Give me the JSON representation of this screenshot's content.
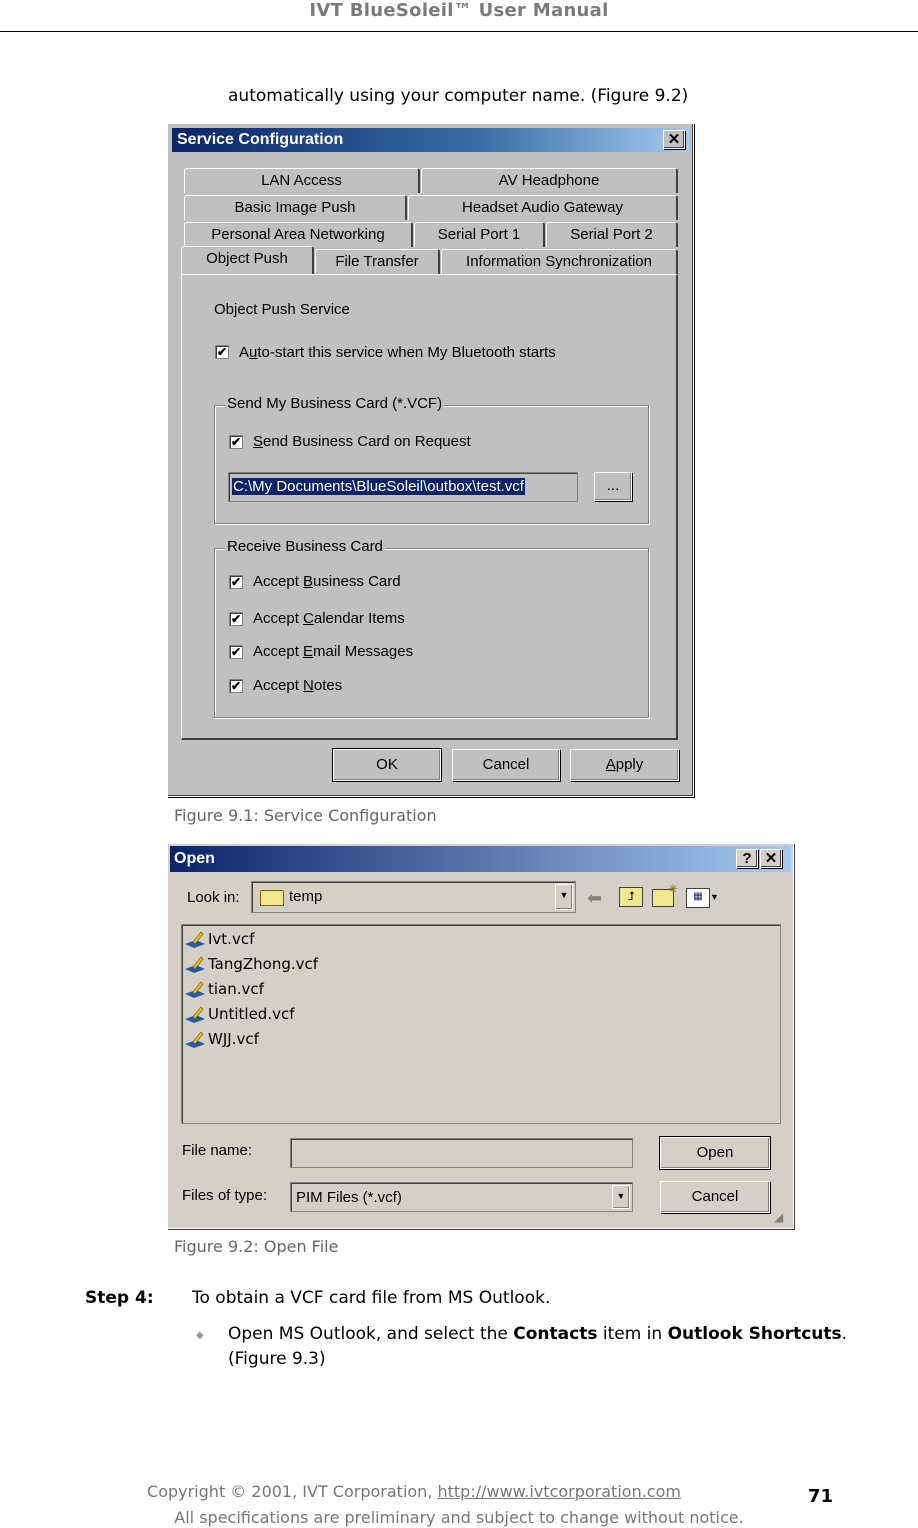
{
  "header": {
    "title": "IVT BlueSoleil™ User Manual"
  },
  "intro_text": "automatically using your computer name. (Figure 9.2)",
  "service_dialog": {
    "title": "Service Configuration",
    "close_label": "✕",
    "tab_rows": [
      [
        "LAN Access",
        "AV Headphone"
      ],
      [
        "Basic Image Push",
        "Headset Audio Gateway"
      ],
      [
        "Personal Area Networking",
        "Serial Port 1",
        "Serial Port 2"
      ],
      [
        "Object Push",
        "File Transfer",
        "Information Synchronization"
      ]
    ],
    "active_tab": "Object Push",
    "section_title": "Object Push Service",
    "autostart": {
      "label_pre": "A",
      "label_u": "u",
      "label_post": "to-start this service when My Bluetooth starts",
      "checked": true
    },
    "send_group": {
      "label": "Send My Business Card (*.VCF)",
      "send_on_request": {
        "label_u": "S",
        "label_post": "end Business Card on Request",
        "checked": true
      },
      "path_value": "C:\\My Documents\\BlueSoleil\\outbox\\test.vcf",
      "browse_label": "..."
    },
    "receive_group": {
      "label": "Receive Business Card",
      "items": [
        {
          "pre": "Accept ",
          "u": "B",
          "post": "usiness Card",
          "checked": true
        },
        {
          "pre": "Accept ",
          "u": "C",
          "post": "alendar Items",
          "checked": true
        },
        {
          "pre": "Accept ",
          "u": "E",
          "post": "mail Messages",
          "checked": true
        },
        {
          "pre": "Accept ",
          "u": "N",
          "post": "otes",
          "checked": true
        }
      ]
    },
    "buttons": {
      "ok": "OK",
      "cancel": "Cancel",
      "apply_u": "A",
      "apply_post": "pply"
    }
  },
  "caption1": "Figure 9.1: Service Configuration",
  "open_dialog": {
    "title": "Open",
    "help_label": "?",
    "close_label": "✕",
    "look_in_label": "Look in:",
    "look_in_value": "temp",
    "files": [
      "Ivt.vcf",
      "TangZhong.vcf",
      "tian.vcf",
      "Untitled.vcf",
      "WJJ.vcf"
    ],
    "file_name_label": "File name:",
    "file_name_value": "",
    "file_type_label": "Files of type:",
    "file_type_value": "PIM Files (*.vcf)",
    "open_button": "Open",
    "cancel_button": "Cancel"
  },
  "caption2": "Figure 9.2: Open File",
  "step": {
    "label": "Step 4:",
    "text": "To obtain a VCF card file from MS Outlook.",
    "bullet": {
      "t1": "Open MS Outlook, and select the ",
      "b1": "Contacts",
      "t2": " item in ",
      "b2": "Outlook Shortcuts",
      "t3": ". (Figure 9.3)"
    }
  },
  "footer": {
    "copyright": "Copyright © 2001, IVT Corporation, ",
    "link": "http://www.ivtcorporation.com",
    "notice": "All specifications are preliminary and subject to change without notice.",
    "page_number": "71"
  }
}
